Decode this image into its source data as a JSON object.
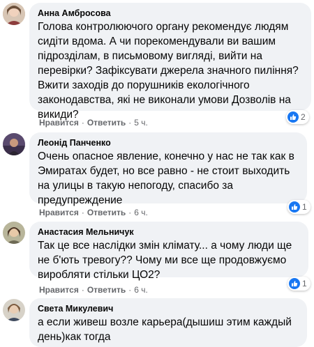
{
  "comments": [
    {
      "author": "Анна Амбросова",
      "text": "Голова контролюючого органу рекомендує людям\nсидіти вдома. А чи порекомендували ви вашим\nпідрозділам, в письмовому вигляді, вийти на\nперевірки? Зафіксувати джерела значного пиління?\nВжити заходів до порушників екологічного\nзаконодавства, які не виконали умови Дозволів на\nвикиди?",
      "like_label": "Нравится",
      "reply_label": "Ответить",
      "time": "5 ч.",
      "reactions": "2"
    },
    {
      "author": "Леонід Панченко",
      "text": "Очень опасное явление, конечно у нас не так как в\nЭмиратах будет, но все равно - не стоит выходить\nна улицы в такую непогоду, спасибо за\nпредупреждение",
      "like_label": "Нравится",
      "reply_label": "Ответить",
      "time": "6 ч.",
      "reactions": "1"
    },
    {
      "author": "Анастасия Мельничук",
      "text": "Так це все наслідки змін клімату... а чому люди ще\nне б'ють тревогу?? Чому ми все ще продовжуємо\nвиробляти стільки ЦО2?",
      "like_label": "Нравится",
      "reply_label": "Ответить",
      "time": "6 ч.",
      "reactions": "1"
    },
    {
      "author": "Света Микулевич",
      "text": "а если живеш возле карьера(дышиш этим каждый\nдень)как тогда",
      "like_label": "",
      "reply_label": "",
      "time": "",
      "reactions": ""
    }
  ],
  "colors": {
    "bubble": "#f0f2f5",
    "meta": "#65676b",
    "like_blue": "#1877f2"
  },
  "icons": {
    "like": "thumbs-up-icon"
  }
}
